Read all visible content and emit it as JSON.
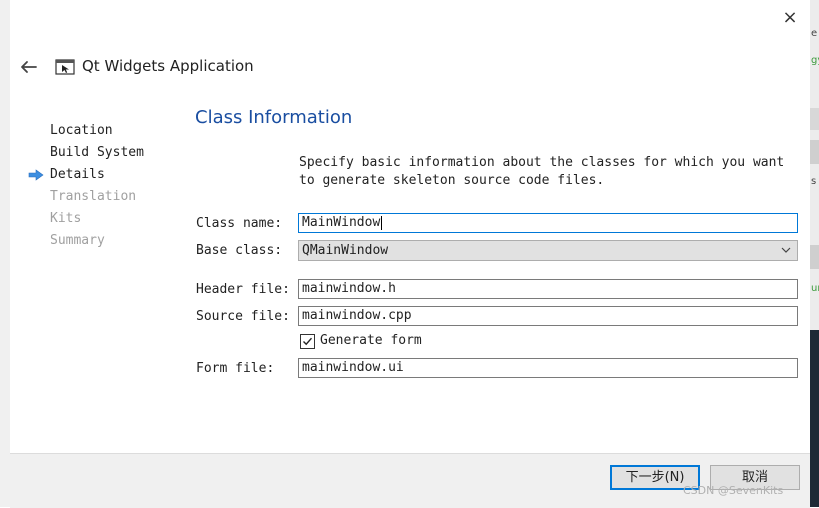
{
  "window": {
    "title": "Qt Widgets Application",
    "close_label": "×"
  },
  "nav": {
    "items": [
      {
        "label": "Location",
        "state": "done"
      },
      {
        "label": "Build System",
        "state": "done"
      },
      {
        "label": "Details",
        "state": "current"
      },
      {
        "label": "Translation",
        "state": "pending"
      },
      {
        "label": "Kits",
        "state": "pending"
      },
      {
        "label": "Summary",
        "state": "pending"
      }
    ]
  },
  "page": {
    "heading": "Class Information",
    "description": "Specify basic information about the classes for which you want to generate skeleton source code files."
  },
  "form": {
    "class_name": {
      "label": "Class name:",
      "value": "MainWindow"
    },
    "base_class": {
      "label": "Base class:",
      "value": "QMainWindow"
    },
    "header_file": {
      "label": "Header file:",
      "value": "mainwindow.h"
    },
    "source_file": {
      "label": "Source file:",
      "value": "mainwindow.cpp"
    },
    "generate_form": {
      "label": "Generate form",
      "checked": true
    },
    "form_file": {
      "label": "Form file:",
      "value": "mainwindow.ui"
    }
  },
  "buttons": {
    "next": "下一步(N)",
    "cancel": "取消"
  },
  "watermark": "CSDN @SevenKits",
  "background_window": {
    "fragments": [
      "e",
      "gy",
      "ur",
      "s"
    ]
  },
  "colors": {
    "accent": "#0078d7",
    "heading": "#1a4ea1",
    "nav_arrow": "#3d8ee0",
    "disabled_text": "#a0a0a0"
  }
}
